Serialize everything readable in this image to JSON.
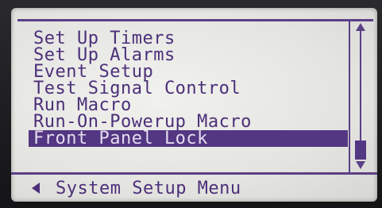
{
  "menu": {
    "items": [
      {
        "label": "Set Up Timers",
        "selected": false
      },
      {
        "label": "Set Up Alarms",
        "selected": false
      },
      {
        "label": "Event Setup",
        "selected": false
      },
      {
        "label": "Test Signal Control",
        "selected": false
      },
      {
        "label": "Run Macro",
        "selected": false
      },
      {
        "label": "Run-On-Powerup Macro",
        "selected": false
      },
      {
        "label": "Front Panel Lock",
        "selected": true
      }
    ]
  },
  "footer": {
    "back_icon": "triangle-left-icon",
    "title": "System Setup Menu"
  },
  "scrollbar": {
    "up_icon": "arrow-up-icon",
    "down_icon": "arrow-down-icon"
  },
  "colors": {
    "lcd_background": "#e6e6e3",
    "ink": "#4c2f79",
    "highlight": "#533782",
    "highlight_text": "#e4dcef"
  }
}
